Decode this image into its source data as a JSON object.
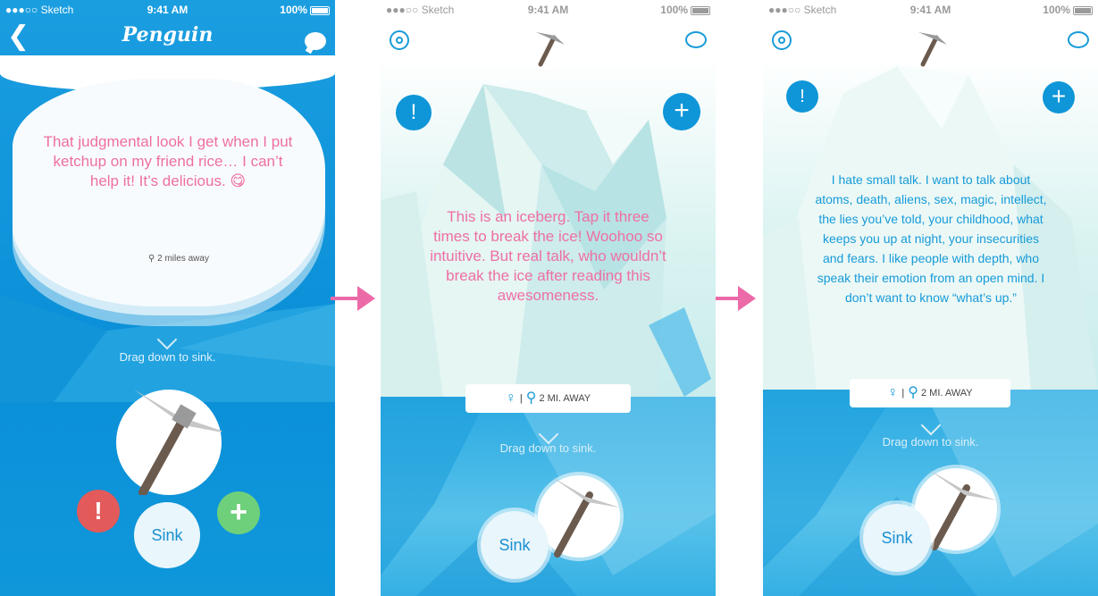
{
  "status": {
    "carrier": "Sketch",
    "time": "9:41 AM",
    "battery": "100%"
  },
  "screen1": {
    "app_title": "Penguin",
    "quote": "That judgmental look I get when I put ketchup on my friend rice… I can’t help it! It’s delicious. 😋",
    "distance": "2 miles away",
    "drag_hint": "Drag down to sink.",
    "report_label": "!",
    "sink_label": "Sink",
    "add_label": "+"
  },
  "screen2": {
    "iceberg_text": "This is an iceberg. Tap it three times to break the ice! Woohoo so intuitive. But real talk, who wouldn’t break the ice after reading this awesomeness.",
    "distance": "2 MI. AWAY",
    "drag_hint": "Drag down to sink.",
    "sink_label": "Sink",
    "report_label": "!",
    "add_label": "+"
  },
  "screen3": {
    "iceberg_text": "I hate small talk. I want to talk about atoms, death, aliens, sex, magic, intellect, the lies you’ve told, your childhood, what keeps you up at night, your insecurities and fears. I like people with depth, who speak their emotion from an open mind. I don’t want to know “what’s up.”",
    "distance": "2 MI. AWAY",
    "drag_hint": "Drag down to sink.",
    "sink_label": "Sink",
    "report_label": "!",
    "add_label": "+"
  },
  "colors": {
    "accent_blue": "#1a9bd8",
    "pink": "#ee6fa3",
    "report_red": "#e25a5a",
    "add_green": "#6fd07b"
  },
  "icons": [
    "back-arrow-icon",
    "chat-icon",
    "settings-gear-icon",
    "ice-pick-icon",
    "location-pin-icon",
    "female-gender-icon",
    "chevron-down-icon"
  ]
}
